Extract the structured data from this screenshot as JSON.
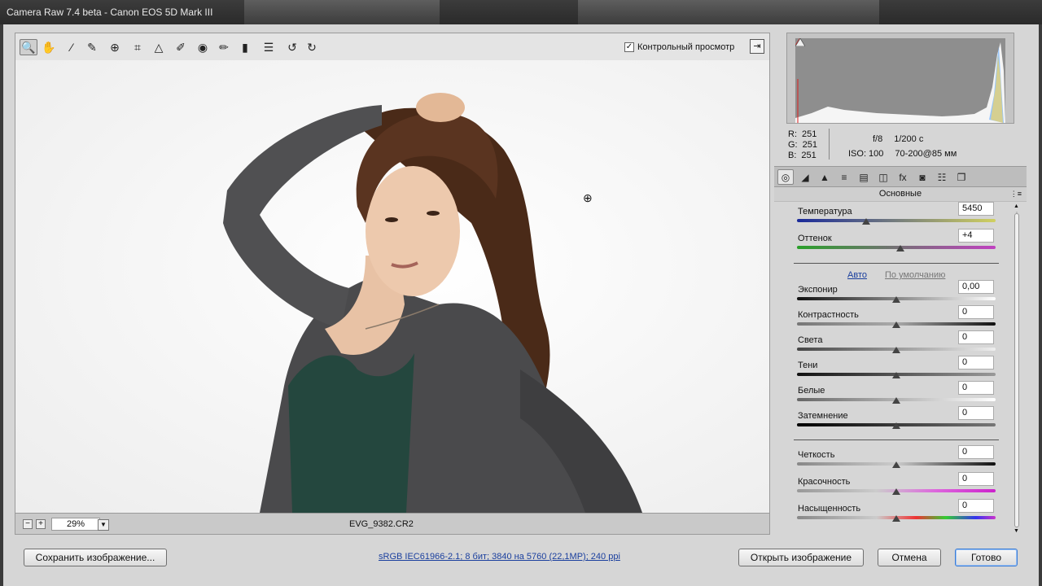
{
  "window": {
    "title": "Camera Raw 7.4 beta  -  Canon EOS 5D Mark III"
  },
  "toolbar": {
    "tools": [
      {
        "name": "zoom-tool",
        "glyph": "🔍"
      },
      {
        "name": "hand-tool",
        "glyph": "✋"
      },
      {
        "name": "white-balance-tool",
        "glyph": "⁄"
      },
      {
        "name": "color-sampler-tool",
        "glyph": "✎"
      },
      {
        "name": "targeted-adjustment-tool",
        "glyph": "⊕"
      },
      {
        "name": "crop-tool",
        "glyph": "⌗"
      },
      {
        "name": "straighten-tool",
        "glyph": "△"
      },
      {
        "name": "spot-removal-tool",
        "glyph": "✐"
      },
      {
        "name": "red-eye-tool",
        "glyph": "◉"
      },
      {
        "name": "adjustment-brush-tool",
        "glyph": "✏"
      },
      {
        "name": "graduated-filter-tool",
        "glyph": "▮"
      },
      {
        "name": "preferences-tool",
        "glyph": "☰"
      },
      {
        "name": "rotate-ccw-tool",
        "glyph": "↺"
      },
      {
        "name": "rotate-cw-tool",
        "glyph": "↻"
      }
    ],
    "preview_label": "Контрольный просмотр",
    "preview_checked": "✓",
    "fullscreen_glyph": "⇥"
  },
  "status": {
    "zoom_out": "−",
    "zoom_in": "+",
    "zoom": "29%",
    "dropdown": "▼",
    "filename": "EVG_9382.CR2"
  },
  "info": {
    "r_label": "R:",
    "r": "251",
    "g_label": "G:",
    "g": "251",
    "b_label": "B:",
    "b": "251",
    "aperture": "f/8",
    "shutter": "1/200 с",
    "iso": "ISO: 100",
    "lens": "70-200@85 мм"
  },
  "tabs": [
    {
      "name": "basic-tab",
      "glyph": "◎"
    },
    {
      "name": "tone-curve-tab",
      "glyph": "◢"
    },
    {
      "name": "detail-tab",
      "glyph": "▲"
    },
    {
      "name": "hsl-tab",
      "glyph": "≡"
    },
    {
      "name": "split-toning-tab",
      "glyph": "▤"
    },
    {
      "name": "lens-corrections-tab",
      "glyph": "◫"
    },
    {
      "name": "effects-tab",
      "glyph": "fx"
    },
    {
      "name": "camera-calibration-tab",
      "glyph": "◙"
    },
    {
      "name": "presets-tab",
      "glyph": "☷"
    },
    {
      "name": "snapshots-tab",
      "glyph": "❐"
    }
  ],
  "basic": {
    "section_title": "Основные",
    "menu_glyph": "⋮≡",
    "temperature_label": "Температура",
    "temperature": "5450",
    "tint_label": "Оттенок",
    "tint": "+4",
    "auto": "Авто",
    "default": "По умолчанию",
    "exposure_label": "Экспонир",
    "exposure": "0,00",
    "contrast_label": "Контрастность",
    "contrast": "0",
    "highlights_label": "Света",
    "highlights": "0",
    "shadows_label": "Тени",
    "shadows": "0",
    "whites_label": "Белые",
    "whites": "0",
    "blacks_label": "Затемнение",
    "blacks": "0",
    "clarity_label": "Четкость",
    "clarity": "0",
    "vibrance_label": "Красочность",
    "vibrance": "0",
    "saturation_label": "Насыщенность",
    "saturation": "0"
  },
  "slider_levels": {
    "temperature": 0.35,
    "tint": 0.52,
    "exposure": 0.5,
    "contrast": 0.5,
    "highlights": 0.5,
    "shadows": 0.5,
    "whites": 0.5,
    "blacks": 0.5,
    "clarity": 0.5,
    "vibrance": 0.5,
    "saturation": 0.5
  },
  "buttons": {
    "save": "Сохранить изображение...",
    "workflow": "sRGB IEC61966-2.1; 8 бит; 3840 на 5760 (22,1МР); 240 ppi",
    "open": "Открыть изображение",
    "cancel": "Отмена",
    "done": "Готово"
  },
  "colors": {
    "accent_link": "#1a3f9e",
    "primary_button_border": "#3a7bd5",
    "jacket": "#4a4a4c",
    "top": "#24473e",
    "hair": "#4a2a18"
  }
}
